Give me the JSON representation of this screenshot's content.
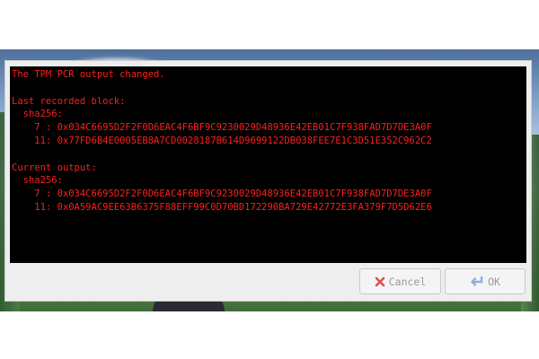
{
  "terminal": {
    "lines": [
      "The TPM PCR output changed.",
      "",
      "Last recorded block:",
      "  sha256:",
      "    7 : 0x034C6695D2F2F0D6EAC4F6BF9C9230029D48936E42EB01C7F938FAD7D7DE3A0F",
      "    11: 0x77FD6B4E0005EB8A7CD0028187B614D9699122DB038FEE7E1C3D51E352C962C2",
      "",
      "Current output:",
      "  sha256:",
      "    7 : 0x034C6695D2F2F0D6EAC4F6BF9C9230029D48936E42EB01C7F938FAD7D7DE3A0F",
      "    11: 0x0A59AC9EE63B6375F88EFF99C0D70BD172290BA729E42772E3FA379F7D5D62E6"
    ],
    "text_color": "#ff1e1e",
    "background_color": "#000000"
  },
  "buttons": {
    "cancel": {
      "label": "Cancel",
      "icon": "x-cross-icon",
      "icon_color": "#e0504a"
    },
    "ok": {
      "label": "OK",
      "icon": "return-arrow-icon",
      "icon_color": "#8fb0d6"
    }
  }
}
